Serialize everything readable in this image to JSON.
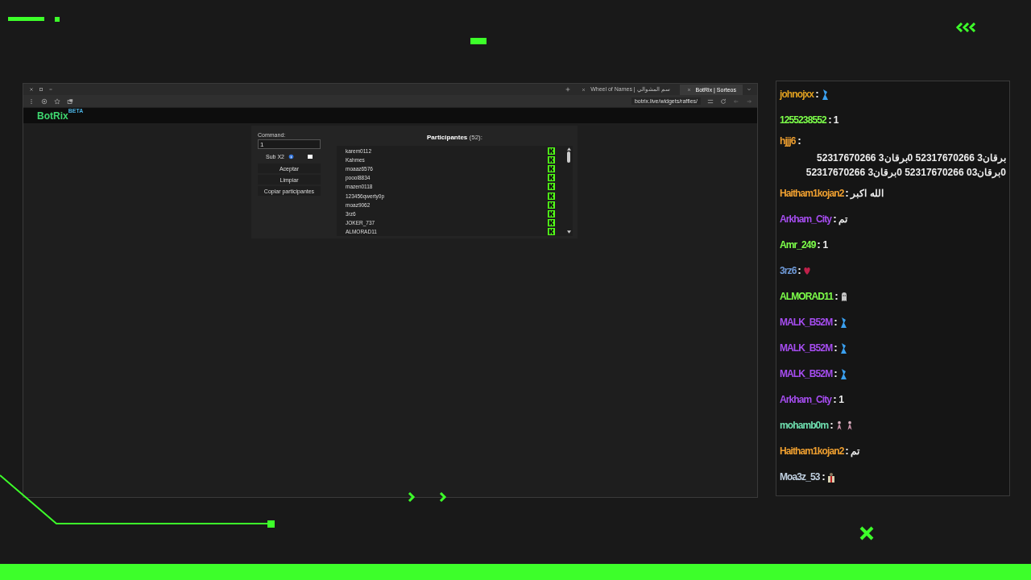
{
  "browser": {
    "tabs": [
      {
        "label": "Wheel of Names | سم المشوالي",
        "selected": false
      },
      {
        "label": "BotRix | Sorteos",
        "selected": true
      }
    ],
    "address": "botrix.live/widgets/raffles/"
  },
  "site": {
    "logo": "BotRix",
    "badge": "BETA"
  },
  "raffle": {
    "command_label": "Command:",
    "command_value": "1",
    "sub_label": "Sub X2",
    "sub_checked": false,
    "buttons": [
      "Aceptar",
      "Limpiar",
      "Copiar participantes"
    ],
    "participants_title": "Participantes",
    "participants_count": "(52):",
    "participants": [
      "karem0112",
      "Kahmes",
      "moaaz6576",
      "poool8834",
      "mazen0118",
      "123456qwerty0p",
      "moaz9062",
      "3rz6",
      "JOKER_737",
      "ALMORAD11"
    ]
  },
  "chat": [
    {
      "user": "johnojxx",
      "color": "#e0a020",
      "kind": "emote",
      "emotes": [
        {
          "kind": "bird"
        }
      ]
    },
    {
      "user": "1255238552",
      "color": "#7dff4a",
      "kind": "text",
      "text": "1"
    },
    {
      "user": "hjjj6",
      "color": "#f0a030",
      "kind": "text",
      "text": "برقان3 52317670266 0برقان3 52317670266 0برقان03 52317670266 0برقان3 52317670266"
    },
    {
      "user": "Haitham1kojan2",
      "color": "#f0a030",
      "kind": "text",
      "text": "الله اكبر"
    },
    {
      "user": "Arkham_City",
      "color": "#a64df0",
      "kind": "text",
      "text": "تم"
    },
    {
      "user": "Amr_249",
      "color": "#7dff4a",
      "kind": "text",
      "text": "1"
    },
    {
      "user": "3rz6",
      "color": "#6f9ad8",
      "kind": "emote",
      "emotes": [
        {
          "kind": "heart"
        }
      ]
    },
    {
      "user": "ALMORAD11",
      "color": "#7dff4a",
      "kind": "emote",
      "emotes": [
        {
          "kind": "ghost"
        }
      ]
    },
    {
      "user": "MALK_B52M",
      "color": "#a64df0",
      "kind": "emote",
      "emotes": [
        {
          "kind": "bird"
        }
      ]
    },
    {
      "user": "MALK_B52M",
      "color": "#a64df0",
      "kind": "emote",
      "emotes": [
        {
          "kind": "bird"
        }
      ]
    },
    {
      "user": "MALK_B52M",
      "color": "#a64df0",
      "kind": "emote",
      "emotes": [
        {
          "kind": "bird"
        }
      ]
    },
    {
      "user": "Arkham_City",
      "color": "#a64df0",
      "kind": "text",
      "text": "1"
    },
    {
      "user": "mohamb0m",
      "color": "#6fe0b0",
      "kind": "emote",
      "emotes": [
        {
          "kind": "dancer"
        },
        {
          "kind": "dancer"
        }
      ]
    },
    {
      "user": "Haitham1kojan2",
      "color": "#f0a030",
      "kind": "text",
      "text": "تم"
    },
    {
      "user": "Moa3z_53",
      "color": "#c0d0e0",
      "kind": "emote",
      "emotes": [
        {
          "kind": "gift"
        }
      ]
    }
  ]
}
